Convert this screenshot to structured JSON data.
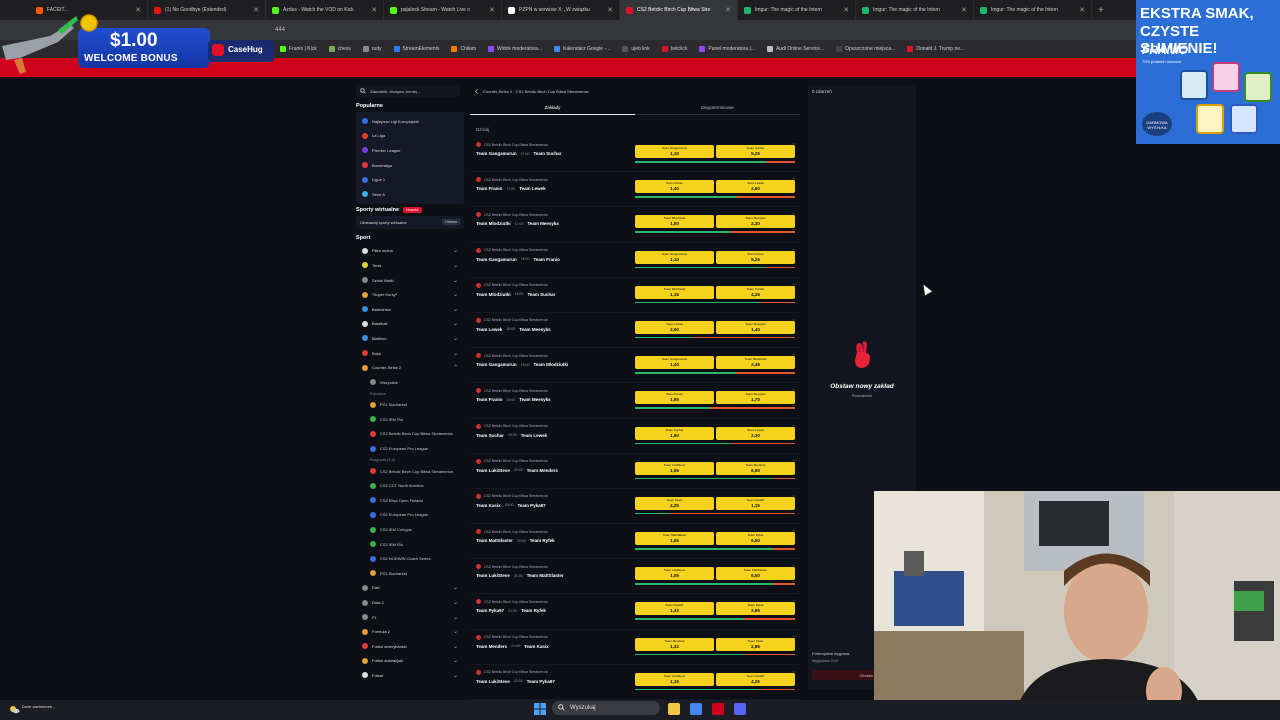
{
  "browser": {
    "tabs": [
      {
        "title": "FACEIT...",
        "color": "#ff5500",
        "active": false
      },
      {
        "title": "(1) No Goodbye (Extended)",
        "color": "#e11",
        "active": false
      },
      {
        "title": "Azdus - Watch the VOD on Kick",
        "color": "#53fc18",
        "active": false
      },
      {
        "title": "pajalock Stream - Watch Live o",
        "color": "#53fc18",
        "active": false
      },
      {
        "title": "PZPN w serwisie X: „W związku",
        "color": "#ffffff",
        "active": false
      },
      {
        "title": "CS2 Betclic Birch Cup Bitwa Stre",
        "color": "#e0122a",
        "active": true
      },
      {
        "title": "Imgur: The magic of the Intern",
        "color": "#1bb76e",
        "active": false
      },
      {
        "title": "Imgur: The magic of the Intern",
        "color": "#1bb76e",
        "active": false
      },
      {
        "title": "Imgur: The magic of the Intern",
        "color": "#1bb76e",
        "active": false
      }
    ],
    "new_tab": "+",
    "address_partial": "444",
    "bookmarks": [
      {
        "label": "Franio | Kick",
        "color": "#53fc18"
      },
      {
        "label": "chess",
        "color": "#7fa650"
      },
      {
        "label": "rudy",
        "color": "#888888"
      },
      {
        "label": "StreamElements",
        "color": "#2d7cf6"
      },
      {
        "label": "Chilam",
        "color": "#ff7700"
      },
      {
        "label": "Widok moderatora...",
        "color": "#9146ff"
      },
      {
        "label": "Kalendarz Google -...",
        "color": "#4285f4"
      },
      {
        "label": "ujeb link",
        "color": "#555555"
      },
      {
        "label": "betclick",
        "color": "#e0122a"
      },
      {
        "label": "Panel moderatora |...",
        "color": "#9146ff"
      },
      {
        "label": "Audi Online Service...",
        "color": "#bbbbbb"
      },
      {
        "label": "Opuszczone miejsca...",
        "color": "#444444"
      },
      {
        "label": "Donald J. Trump ne...",
        "color": "#e0122a"
      }
    ]
  },
  "promo_left": {
    "amount": "$1.00",
    "label": "WELCOME BONUS",
    "brand": "CaseHug"
  },
  "ad_right": {
    "line1": "EKSTRA SMAK,",
    "line2": "CZYSTE SUMIENIE!",
    "brand": "FRANIO",
    "small": "70% polskich owoców",
    "badge": "DARMOWA WYSYŁKA"
  },
  "sidebar": {
    "search_placeholder": "Zawodnik, drużyna, turniej...",
    "popular_title": "Popularne",
    "popular": [
      {
        "label": "Najlepsze Ligi Europejskie",
        "color": "#3b6fe0"
      },
      {
        "label": "La Liga",
        "color": "#e03b3b"
      },
      {
        "label": "Premier League",
        "color": "#7a3be0"
      },
      {
        "label": "Bundesliga",
        "color": "#e03b3b"
      },
      {
        "label": "Ligue 1",
        "color": "#3b6fe0"
      },
      {
        "label": "Serie A",
        "color": "#3bb0e0"
      }
    ],
    "virtual_title": "Sporty wirtualne",
    "virtual_badge": "Nowość",
    "virtual_item": "Obstawiaj sporty wirtualne",
    "virtual_btn": "Obstaw",
    "sport_title": "Sport",
    "sports": [
      {
        "label": "Piłka nożna",
        "color": "#dddddd",
        "open": false
      },
      {
        "label": "Tenis",
        "color": "#e0d23b",
        "open": false
      },
      {
        "label": "Sztuki Walki",
        "color": "#888888",
        "open": false
      },
      {
        "label": "*Super Kursy*",
        "color": "#e0a03b",
        "open": false
      },
      {
        "label": "Badminton",
        "color": "#3b8fe0",
        "open": false
      },
      {
        "label": "Baseball",
        "color": "#dddddd",
        "open": false
      },
      {
        "label": "Biathlon",
        "color": "#3b8fe0",
        "open": false
      },
      {
        "label": "Boks",
        "color": "#e03b3b",
        "open": false
      },
      {
        "label": "Counter-Strike 2",
        "color": "#e0a03b",
        "open": true
      }
    ],
    "cs_sub": {
      "all": "Wszystkie",
      "popular_head": "Popularne",
      "popular": [
        {
          "label": "PGL Bucharest",
          "color": "#e0a03b"
        },
        {
          "label": "CS2 IEM Rio",
          "color": "#3bb04b"
        },
        {
          "label": "CS2 Betclic Birch Cup Bitwa Streamerów",
          "color": "#e03b3b"
        },
        {
          "label": "CS2 European Pro League",
          "color": "#3b6fe0"
        }
      ],
      "other_head": "Rozgrywki (A-Z)",
      "others": [
        {
          "label": "CS2 Betclic Birch Cup Bitwa Streamerów",
          "color": "#e03b3b"
        },
        {
          "label": "CS2 CCT North America",
          "color": "#3bb04b"
        },
        {
          "label": "CS2 Elisa Open Finland",
          "color": "#3b6fe0"
        },
        {
          "label": "CS2 European Pro League",
          "color": "#3b6fe0"
        },
        {
          "label": "CS2 IEM Cologne",
          "color": "#3bb04b"
        },
        {
          "label": "CS2 IEM Rio",
          "color": "#3bb04b"
        },
        {
          "label": "CS2 NODWIN Clutch Series",
          "color": "#3b6fe0"
        },
        {
          "label": "PGL Bucharest",
          "color": "#e0a03b"
        }
      ]
    },
    "sports_after": [
      {
        "label": "Dart",
        "color": "#888888"
      },
      {
        "label": "Dota 2",
        "color": "#888888"
      },
      {
        "label": "F1",
        "color": "#888888"
      },
      {
        "label": "Formuła 2",
        "color": "#e0a03b"
      },
      {
        "label": "Futbol amerykański",
        "color": "#e03b3b"
      },
      {
        "label": "Futbol australijski",
        "color": "#e0a03b"
      },
      {
        "label": "Futsal",
        "color": "#dddddd"
      }
    ]
  },
  "center": {
    "breadcrumb": "Counter-Strike 2 · CS2 Betclic Birch Cup Bitwa Streamerów",
    "tabs": [
      {
        "label": "Zakłady",
        "active": true
      },
      {
        "label": "Długoterminowe",
        "active": false
      }
    ],
    "day_label": "Dzisiaj",
    "competition": "CS2 Betclic Birch Cup Bitwa Streamerów",
    "matches": [
      {
        "team1": "Team Gangamurun",
        "time": "17:00",
        "team2": "Team Suchar",
        "odd1": "1,10",
        "odd2": "5,25",
        "bar1": 0.82,
        "bar2": 0.18
      },
      {
        "team1": "Team Franio",
        "time": "17:00",
        "team2": "Team Lewek",
        "odd1": "1,40",
        "odd2": "2,60",
        "bar1": 0.64,
        "bar2": 0.36
      },
      {
        "team1": "Team Mlodziutki",
        "time": "17:00",
        "team2": "Team Meesyks",
        "odd1": "1,50",
        "odd2": "2,30",
        "bar1": 0.6,
        "bar2": 0.4
      },
      {
        "team1": "Team Gangamurun",
        "time": "18:00",
        "team2": "Team Franio",
        "odd1": "1,10",
        "odd2": "5,25",
        "bar1": 0.82,
        "bar2": 0.18
      },
      {
        "team1": "Team Mlodziutki",
        "time": "18:00",
        "team2": "Team Suchar",
        "odd1": "1,15",
        "odd2": "4,25",
        "bar1": 0.78,
        "bar2": 0.22
      },
      {
        "team1": "Team Lewek",
        "time": "18:00",
        "team2": "Team Meesyks",
        "odd1": "2,60",
        "odd2": "1,40",
        "bar1": 0.36,
        "bar2": 0.64
      },
      {
        "team1": "Team Gangamurun",
        "time": "19:00",
        "team2": "Team Mlodziutki",
        "odd1": "1,40",
        "odd2": "2,45",
        "bar1": 0.63,
        "bar2": 0.37
      },
      {
        "team1": "Team Franio",
        "time": "19:00",
        "team2": "Team Meesyks",
        "odd1": "1,95",
        "odd2": "1,70",
        "bar1": 0.47,
        "bar2": 0.53
      },
      {
        "team1": "Team Suchar",
        "time": "19:00",
        "team2": "Team Lewek",
        "odd1": "1,50",
        "odd2": "2,30",
        "bar1": 0.6,
        "bar2": 0.4
      },
      {
        "team1": "Team LukiSteve",
        "time": "20:00",
        "team2": "Team Menders",
        "odd1": "1,05",
        "odd2": "6,50",
        "bar1": 0.86,
        "bar2": 0.14
      },
      {
        "team1": "Team Kasix",
        "time": "20:00",
        "team2": "Team Pyka97",
        "odd1": "4,25",
        "odd2": "1,15",
        "bar1": 0.22,
        "bar2": 0.78
      },
      {
        "team1": "Team MattSlaster",
        "time": "20:00",
        "team2": "Team Ryfek",
        "odd1": "1,05",
        "odd2": "6,50",
        "bar1": 0.86,
        "bar2": 0.14
      },
      {
        "team1": "Team LukiSteve",
        "time": "21:00",
        "team2": "Team MattSlaster",
        "odd1": "1,05",
        "odd2": "6,50",
        "bar1": 0.86,
        "bar2": 0.14
      },
      {
        "team1": "Team Pyka97",
        "time": "21:00",
        "team2": "Team Ryfek",
        "odd1": "1,33",
        "odd2": "2,85",
        "bar1": 0.68,
        "bar2": 0.32
      },
      {
        "team1": "Team Menders",
        "time": "21:00",
        "team2": "Team Kasix",
        "odd1": "1,33",
        "odd2": "2,85",
        "bar1": 0.68,
        "bar2": 0.32
      },
      {
        "team1": "Team LukiSteve",
        "time": "22:00",
        "team2": "Team Pyka97",
        "odd1": "1,15",
        "odd2": "4,25",
        "bar1": 0.78,
        "bar2": 0.22
      }
    ]
  },
  "betslip": {
    "header": "0 zdarzeń",
    "empty_title": "Obstaw nowy zakład",
    "empty_sub": "Powodzenia!",
    "potential_label": "Potencjalna wygrana:",
    "potential_value": "Wygrywasz 0,00",
    "submit": "Obstaw"
  },
  "taskbar": {
    "weather": "Duże zachmurze...",
    "search_label": "Wyszukaj",
    "apps": [
      {
        "name": "explorer",
        "color": "#f2c744"
      },
      {
        "name": "chrome",
        "color": "#4285f4"
      },
      {
        "name": "app-red",
        "color": "#d0021b"
      },
      {
        "name": "discord",
        "color": "#5865f2"
      }
    ]
  }
}
